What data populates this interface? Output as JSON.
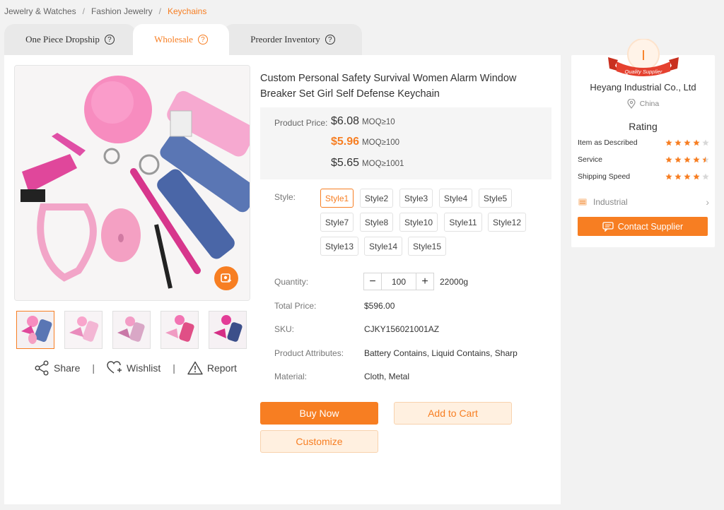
{
  "breadcrumb": {
    "items": [
      "Jewelry & Watches",
      "Fashion Jewelry"
    ],
    "current": "Keychains"
  },
  "tabs": [
    {
      "label": "One Piece Dropship"
    },
    {
      "label": "Wholesale"
    },
    {
      "label": "Preorder Inventory"
    }
  ],
  "product": {
    "title": "Custom Personal Safety Survival Women Alarm Window Breaker Set Girl Self Defense Keychain",
    "price_label": "Product Price:",
    "prices": [
      {
        "price": "$6.08",
        "moq": "MOQ≥10"
      },
      {
        "price": "$5.96",
        "moq": "MOQ≥100"
      },
      {
        "price": "$5.65",
        "moq": "MOQ≥1001"
      }
    ],
    "style_label": "Style:",
    "styles": [
      "Style1",
      "Style2",
      "Style3",
      "Style4",
      "Style5",
      "Style7",
      "Style8",
      "Style10",
      "Style11",
      "Style12",
      "Style13",
      "Style14",
      "Style15"
    ],
    "selected_style": "Style1",
    "quantity_label": "Quantity:",
    "quantity": "100",
    "weight": "22000g",
    "total_label": "Total Price:",
    "total": "$596.00",
    "sku_label": "SKU:",
    "sku": "CJKY156021001AZ",
    "attributes_label": "Product Attributes:",
    "attributes": "Battery Contains, Liquid Contains, Sharp",
    "material_label": "Material:",
    "material": "Cloth, Metal"
  },
  "buttons": {
    "buy": "Buy Now",
    "cart": "Add to Cart",
    "customize": "Customize"
  },
  "gallery_actions": {
    "share": "Share",
    "wishlist": "Wishlist",
    "report": "Report"
  },
  "supplier": {
    "badge_letter": "I",
    "badge_text": "Quality Supplier",
    "name": "Heyang Industrial Co., Ltd",
    "country": "China",
    "rating_title": "Rating",
    "ratings": [
      {
        "label": "Item as Described",
        "stars": 4
      },
      {
        "label": "Service",
        "stars": 4.5
      },
      {
        "label": "Shipping Speed",
        "stars": 4
      }
    ],
    "category": "Industrial",
    "contact": "Contact Supplier"
  },
  "colors": {
    "accent": "#f77e22",
    "accent_light": "#fff0e0",
    "medal_red": "#e5412f",
    "product_pink": "#f39dc6"
  }
}
